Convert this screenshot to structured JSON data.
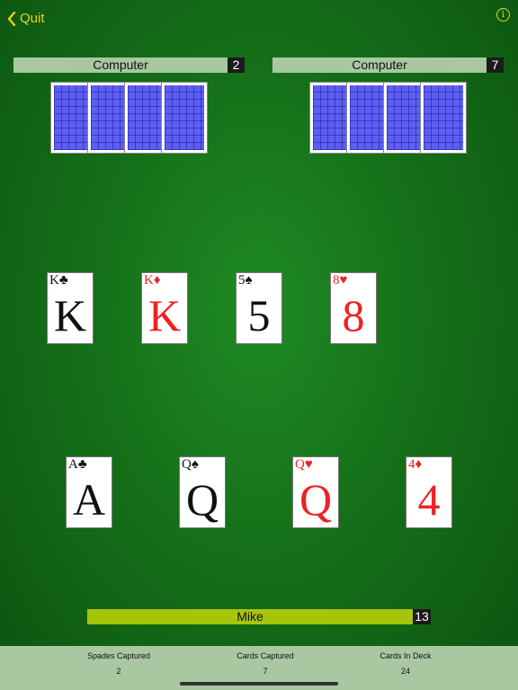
{
  "header": {
    "quit_label": "Quit",
    "info_symbol": "i"
  },
  "opponents": [
    {
      "name": "Computer",
      "count": "2"
    },
    {
      "name": "Computer",
      "count": "7"
    }
  ],
  "table_cards": [
    {
      "rank": "K",
      "suit": "♣",
      "color": "black"
    },
    {
      "rank": "K",
      "suit": "♦",
      "color": "red"
    },
    {
      "rank": "5",
      "suit": "♠",
      "color": "black"
    },
    {
      "rank": "8",
      "suit": "♥",
      "color": "red"
    }
  ],
  "hand_cards": [
    {
      "rank": "A",
      "suit": "♣",
      "color": "black"
    },
    {
      "rank": "Q",
      "suit": "♠",
      "color": "black"
    },
    {
      "rank": "Q",
      "suit": "♥",
      "color": "red"
    },
    {
      "rank": "4",
      "suit": "♦",
      "color": "red"
    }
  ],
  "player": {
    "name": "Mike",
    "count": "13"
  },
  "stats": [
    {
      "label": "Spades Captured",
      "value": "2"
    },
    {
      "label": "Cards Captured",
      "value": "7"
    },
    {
      "label": "Cards In Deck",
      "value": "24"
    }
  ]
}
